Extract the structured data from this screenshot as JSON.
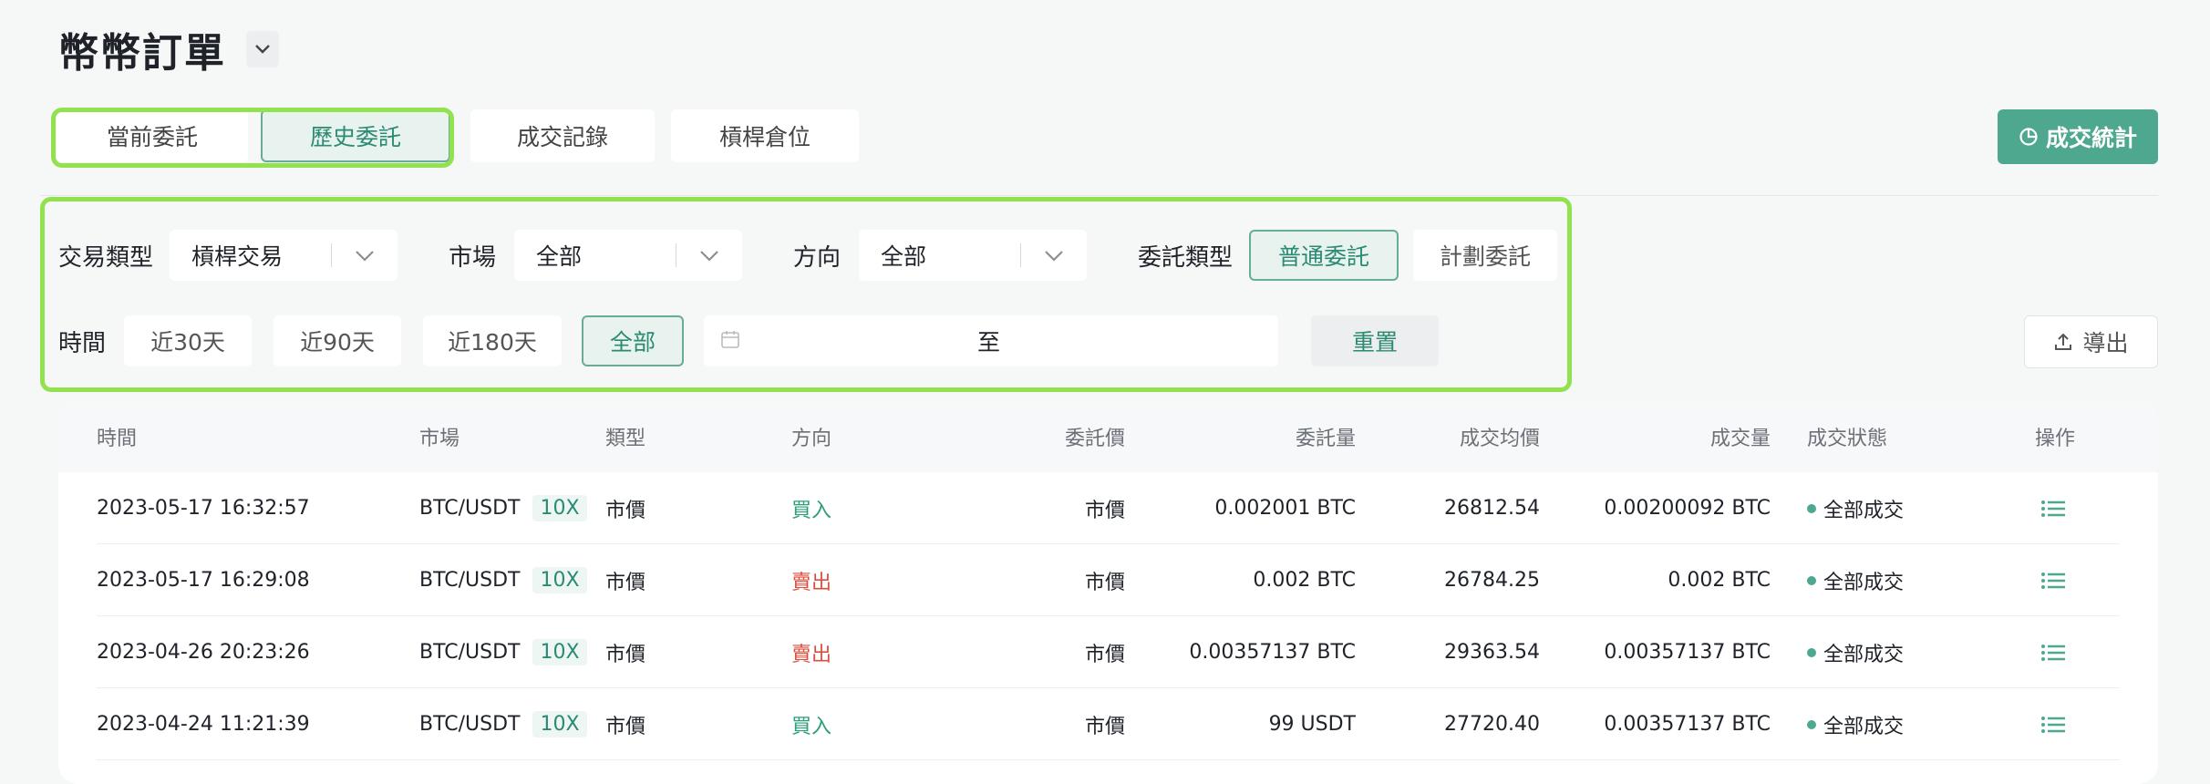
{
  "page": {
    "title": "幣幣訂單"
  },
  "tabs": [
    {
      "label": "當前委託",
      "active": false
    },
    {
      "label": "歷史委託",
      "active": true
    },
    {
      "label": "成交記錄",
      "active": false
    },
    {
      "label": "槓桿倉位",
      "active": false
    }
  ],
  "stats_button": "成交統計",
  "filters": {
    "trade_type": {
      "label": "交易類型",
      "value": "槓桿交易"
    },
    "market": {
      "label": "市場",
      "value": "全部"
    },
    "direction": {
      "label": "方向",
      "value": "全部"
    },
    "order_type": {
      "label": "委託類型",
      "options": [
        "普通委託",
        "計劃委託"
      ],
      "selected": "普通委託"
    },
    "time": {
      "label": "時間",
      "options": [
        "近30天",
        "近90天",
        "近180天",
        "全部"
      ],
      "selected": "全部"
    },
    "date_range_separator": "至",
    "reset": "重置"
  },
  "export_button": "導出",
  "table": {
    "headers": {
      "time": "時間",
      "market": "市場",
      "type": "類型",
      "side": "方向",
      "price": "委託價",
      "amount": "委託量",
      "avg_price": "成交均價",
      "filled": "成交量",
      "status": "成交狀態",
      "action": "操作"
    },
    "rows": [
      {
        "time": "2023-05-17 16:32:57",
        "market": "BTC/USDT",
        "leverage": "10X",
        "type": "市價",
        "side": "買入",
        "side_kind": "buy",
        "price": "市價",
        "amount": "0.002001 BTC",
        "avg_price": "26812.54",
        "filled": "0.00200092 BTC",
        "status": "全部成交"
      },
      {
        "time": "2023-05-17 16:29:08",
        "market": "BTC/USDT",
        "leverage": "10X",
        "type": "市價",
        "side": "賣出",
        "side_kind": "sell",
        "price": "市價",
        "amount": "0.002 BTC",
        "avg_price": "26784.25",
        "filled": "0.002 BTC",
        "status": "全部成交"
      },
      {
        "time": "2023-04-26 20:23:26",
        "market": "BTC/USDT",
        "leverage": "10X",
        "type": "市價",
        "side": "賣出",
        "side_kind": "sell",
        "price": "市價",
        "amount": "0.00357137 BTC",
        "avg_price": "29363.54",
        "filled": "0.00357137 BTC",
        "status": "全部成交"
      },
      {
        "time": "2023-04-24 11:21:39",
        "market": "BTC/USDT",
        "leverage": "10X",
        "type": "市價",
        "side": "買入",
        "side_kind": "buy",
        "price": "市價",
        "amount": "99 USDT",
        "avg_price": "27720.40",
        "filled": "0.00357137 BTC",
        "status": "全部成交"
      }
    ]
  },
  "colors": {
    "accent": "#4ea88f",
    "buy": "#2b9e7c",
    "sell": "#d9503f",
    "highlight": "#92e24f"
  }
}
